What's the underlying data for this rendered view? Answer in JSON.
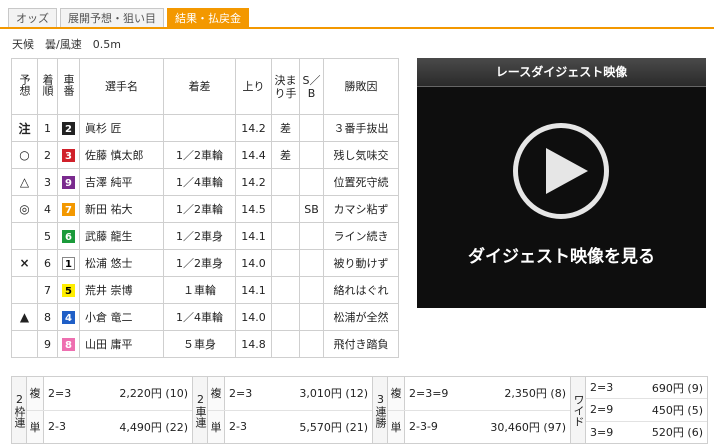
{
  "tabs": [
    {
      "label": "オッズ",
      "active": false
    },
    {
      "label": "展開予想・狙い目",
      "active": false
    },
    {
      "label": "結果・払戻金",
      "active": true
    }
  ],
  "weather": {
    "text": "天候　曇/風速　0.5m"
  },
  "table": {
    "headers": {
      "pred": "予想",
      "finish": "着順",
      "bike": "車番",
      "name": "選手名",
      "margin": "着差",
      "last": "上り",
      "kimarite": "決まり手",
      "sb": "S／B",
      "reason": "勝敗因"
    },
    "rows": [
      {
        "pred": "注",
        "finish": "1",
        "bike": "2",
        "name": "眞杉 匠",
        "margin": "",
        "last": "14.2",
        "kimarite": "差",
        "sb": "",
        "reason": "３番手抜出"
      },
      {
        "pred": "○",
        "finish": "2",
        "bike": "3",
        "name": "佐藤 慎太郎",
        "margin": "1／2車輪",
        "last": "14.4",
        "kimarite": "差",
        "sb": "",
        "reason": "残し気味交"
      },
      {
        "pred": "△",
        "finish": "3",
        "bike": "9",
        "name": "吉澤 純平",
        "margin": "1／4車輪",
        "last": "14.2",
        "kimarite": "",
        "sb": "",
        "reason": "位置死守続"
      },
      {
        "pred": "◎",
        "finish": "4",
        "bike": "7",
        "name": "新田 祐大",
        "margin": "1／2車輪",
        "last": "14.5",
        "kimarite": "",
        "sb": "SB",
        "reason": "カマシ粘ず"
      },
      {
        "pred": "",
        "finish": "5",
        "bike": "6",
        "name": "武藤 龍生",
        "margin": "1／2車身",
        "last": "14.1",
        "kimarite": "",
        "sb": "",
        "reason": "ライン続き"
      },
      {
        "pred": "×",
        "finish": "6",
        "bike": "1",
        "name": "松浦 悠士",
        "margin": "1／2車身",
        "last": "14.0",
        "kimarite": "",
        "sb": "",
        "reason": "被り動けず"
      },
      {
        "pred": "",
        "finish": "7",
        "bike": "5",
        "name": "荒井 崇博",
        "margin": "１車輪",
        "last": "14.1",
        "kimarite": "",
        "sb": "",
        "reason": "絡れはぐれ"
      },
      {
        "pred": "▲",
        "finish": "8",
        "bike": "4",
        "name": "小倉 竜二",
        "margin": "1／4車輪",
        "last": "14.0",
        "kimarite": "",
        "sb": "",
        "reason": "松浦が全然"
      },
      {
        "pred": "",
        "finish": "9",
        "bike": "8",
        "name": "山田 庸平",
        "margin": "５車身",
        "last": "14.8",
        "kimarite": "",
        "sb": "",
        "reason": "飛付き踏負"
      }
    ]
  },
  "bike_colors": {
    "1": {
      "bg": "#ffffff",
      "fg": "#000000"
    },
    "2": {
      "bg": "#222222",
      "fg": "#ffffff"
    },
    "3": {
      "bg": "#d0202a",
      "fg": "#ffffff"
    },
    "4": {
      "bg": "#1f5fc7",
      "fg": "#ffffff"
    },
    "5": {
      "bg": "#ffee00",
      "fg": "#000000"
    },
    "6": {
      "bg": "#1a9a3a",
      "fg": "#ffffff"
    },
    "7": {
      "bg": "#f39800",
      "fg": "#ffffff"
    },
    "8": {
      "bg": "#ee6fb0",
      "fg": "#ffffff"
    },
    "9": {
      "bg": "#7a2a8e",
      "fg": "#ffffff"
    }
  },
  "video": {
    "title": "レースダイジェスト映像",
    "cta": "ダイジェスト映像を見る",
    "icon": "play-icon"
  },
  "payout": {
    "wakuren": {
      "label": "2枠連",
      "rows": [
        {
          "kind": "複",
          "combo": "2=3",
          "amount": "2,220円 (10)"
        },
        {
          "kind": "単",
          "combo": "2-3",
          "amount": "4,490円 (22)"
        }
      ]
    },
    "shaban": {
      "label": "2車連",
      "rows": [
        {
          "kind": "複",
          "combo": "2=3",
          "amount": "3,010円 (12)"
        },
        {
          "kind": "単",
          "combo": "2-3",
          "amount": "5,570円 (21)"
        }
      ]
    },
    "sanrentan": {
      "label": "3連勝",
      "rows": [
        {
          "kind": "複",
          "combo": "2=3=9",
          "amount": "2,350円 (8)"
        },
        {
          "kind": "単",
          "combo": "2-3-9",
          "amount": "30,460円 (97)"
        }
      ]
    },
    "wide": {
      "label": "ワイド",
      "rows": [
        {
          "combo": "2=3",
          "amount": "690円 (9)"
        },
        {
          "combo": "2=9",
          "amount": "450円 (5)"
        },
        {
          "combo": "3=9",
          "amount": "520円 (6)"
        }
      ]
    }
  }
}
